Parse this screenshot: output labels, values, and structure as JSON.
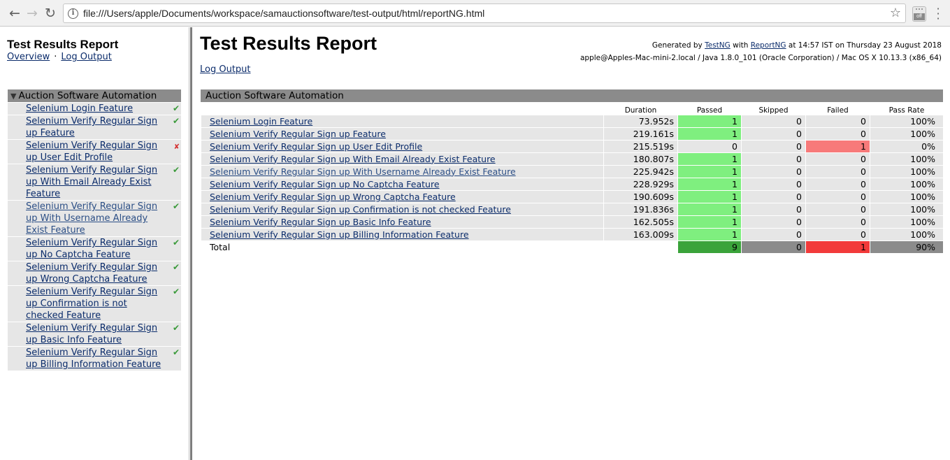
{
  "browser": {
    "back_icon": "arrow-left-icon",
    "forward_icon": "arrow-right-icon",
    "reload_icon": "reload-icon",
    "info_icon": "info-icon",
    "url": "file:///Users/apple/Documents/workspace/samauctionsoftware/test-output/html/reportNG.html",
    "bookmark_icon": "star-icon",
    "extension_badge": "off",
    "menu_icon": "vertical-dots-icon"
  },
  "nav": {
    "title": "Test Results Report",
    "overview_link": "Overview",
    "separator": "·",
    "log_output_link": "Log Output",
    "suite_name": "Auction Software Automation",
    "tests": [
      {
        "label": "Selenium Login Feature",
        "status": "pass"
      },
      {
        "label": "Selenium Verify Regular Sign up Feature",
        "status": "pass"
      },
      {
        "label": "Selenium Verify Regular Sign up User Edit Profile",
        "status": "fail"
      },
      {
        "label": "Selenium Verify Regular Sign up With Email Already Exist Feature",
        "status": "pass"
      },
      {
        "label": "Selenium Verify Regular Sign up With Username Already Exist Feature",
        "status": "pass"
      },
      {
        "label": "Selenium Verify Regular Sign up No Captcha Feature",
        "status": "pass"
      },
      {
        "label": "Selenium Verify Regular Sign up Wrong Captcha Feature",
        "status": "pass"
      },
      {
        "label": "Selenium Verify Regular Sign up Confirmation is not checked Feature",
        "status": "pass"
      },
      {
        "label": "Selenium Verify Regular Sign up Basic Info Feature",
        "status": "pass"
      },
      {
        "label": "Selenium Verify Regular Sign up Billing Information Feature",
        "status": "pass"
      }
    ],
    "pass_mark": "✔",
    "fail_mark": "✘"
  },
  "main": {
    "title": "Test Results Report",
    "generated_prefix": "Generated by",
    "testng": "TestNG",
    "with": "with",
    "reportng": "ReportNG",
    "generated_suffix": "at 14:57 IST on Thursday 23 August 2018",
    "system_info": "apple@Apples-Mac-mini-2.local / Java 1.8.0_101 (Oracle Corporation) / Mac OS X 10.13.3 (x86_64)",
    "log_output_link": "Log Output",
    "suite_name": "Auction Software Automation",
    "columns": {
      "duration": "Duration",
      "passed": "Passed",
      "skipped": "Skipped",
      "failed": "Failed",
      "pass_rate": "Pass Rate"
    },
    "rows": [
      {
        "name": "Selenium Login Feature",
        "duration": "73.952s",
        "passed": "1",
        "skipped": "0",
        "failed": "0",
        "pass_rate": "100%"
      },
      {
        "name": "Selenium Verify Regular Sign up Feature",
        "duration": "219.161s",
        "passed": "1",
        "skipped": "0",
        "failed": "0",
        "pass_rate": "100%"
      },
      {
        "name": "Selenium Verify Regular Sign up User Edit Profile",
        "duration": "215.519s",
        "passed": "0",
        "skipped": "0",
        "failed": "1",
        "pass_rate": "0%"
      },
      {
        "name": "Selenium Verify Regular Sign up With Email Already Exist Feature",
        "duration": "180.807s",
        "passed": "1",
        "skipped": "0",
        "failed": "0",
        "pass_rate": "100%"
      },
      {
        "name": "Selenium Verify Regular Sign up With Username Already Exist Feature",
        "duration": "225.942s",
        "passed": "1",
        "skipped": "0",
        "failed": "0",
        "pass_rate": "100%"
      },
      {
        "name": "Selenium Verify Regular Sign up No Captcha Feature",
        "duration": "228.929s",
        "passed": "1",
        "skipped": "0",
        "failed": "0",
        "pass_rate": "100%"
      },
      {
        "name": "Selenium Verify Regular Sign up Wrong Captcha Feature",
        "duration": "190.609s",
        "passed": "1",
        "skipped": "0",
        "failed": "0",
        "pass_rate": "100%"
      },
      {
        "name": "Selenium Verify Regular Sign up Confirmation is not checked Feature",
        "duration": "191.836s",
        "passed": "1",
        "skipped": "0",
        "failed": "0",
        "pass_rate": "100%"
      },
      {
        "name": "Selenium Verify Regular Sign up Basic Info Feature",
        "duration": "162.505s",
        "passed": "1",
        "skipped": "0",
        "failed": "0",
        "pass_rate": "100%"
      },
      {
        "name": "Selenium Verify Regular Sign up Billing Information Feature",
        "duration": "163.009s",
        "passed": "1",
        "skipped": "0",
        "failed": "0",
        "pass_rate": "100%"
      }
    ],
    "total": {
      "label": "Total",
      "passed": "9",
      "skipped": "0",
      "failed": "1",
      "pass_rate": "90%"
    }
  },
  "colors": {
    "pass_cell": "#7fef7f",
    "fail_cell": "#f77a7a",
    "total_pass": "#3aa33a",
    "total_fail": "#f23a3a",
    "header_gray": "#8b8b8b",
    "row_gray": "#e6e6e6",
    "link": "#0b2c6b"
  }
}
